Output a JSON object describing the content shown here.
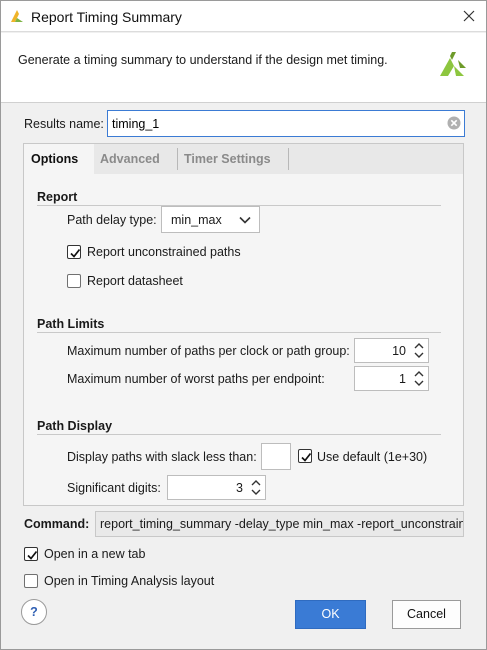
{
  "window": {
    "title": "Report Timing Summary"
  },
  "header": {
    "description": "Generate a timing summary to understand if the design met timing."
  },
  "results": {
    "label": "Results name:",
    "value": "timing_1"
  },
  "tabs": [
    {
      "label": "Options"
    },
    {
      "label": "Advanced"
    },
    {
      "label": "Timer Settings"
    }
  ],
  "report": {
    "title": "Report",
    "path_delay_label": "Path delay type:",
    "path_delay_value": "min_max",
    "unconstrained_label": "Report unconstrained paths",
    "unconstrained_checked": true,
    "datasheet_label": "Report datasheet",
    "datasheet_checked": false
  },
  "path_limits": {
    "title": "Path Limits",
    "max_paths_label": "Maximum number of paths per clock or path group:",
    "max_paths_value": "10",
    "worst_paths_label": "Maximum number of worst paths per endpoint:",
    "worst_paths_value": "1"
  },
  "path_display": {
    "title": "Path Display",
    "slack_label": "Display paths with slack less than:",
    "slack_value": "",
    "use_default_label": "Use default (1e+30)",
    "use_default_checked": true,
    "sig_digits_label": "Significant digits:",
    "sig_digits_value": "3"
  },
  "command": {
    "label": "Command:",
    "value": "report_timing_summary -delay_type min_max -report_unconstrained"
  },
  "options": {
    "new_tab_label": "Open in a new tab",
    "new_tab_checked": true,
    "timing_layout_label": "Open in Timing Analysis layout",
    "timing_layout_checked": false
  },
  "buttons": {
    "help": "?",
    "ok": "OK",
    "cancel": "Cancel"
  },
  "colors": {
    "accent": "#3a7bd5",
    "logo": "#8dc63f",
    "logo_dark": "#6e9b2a"
  }
}
